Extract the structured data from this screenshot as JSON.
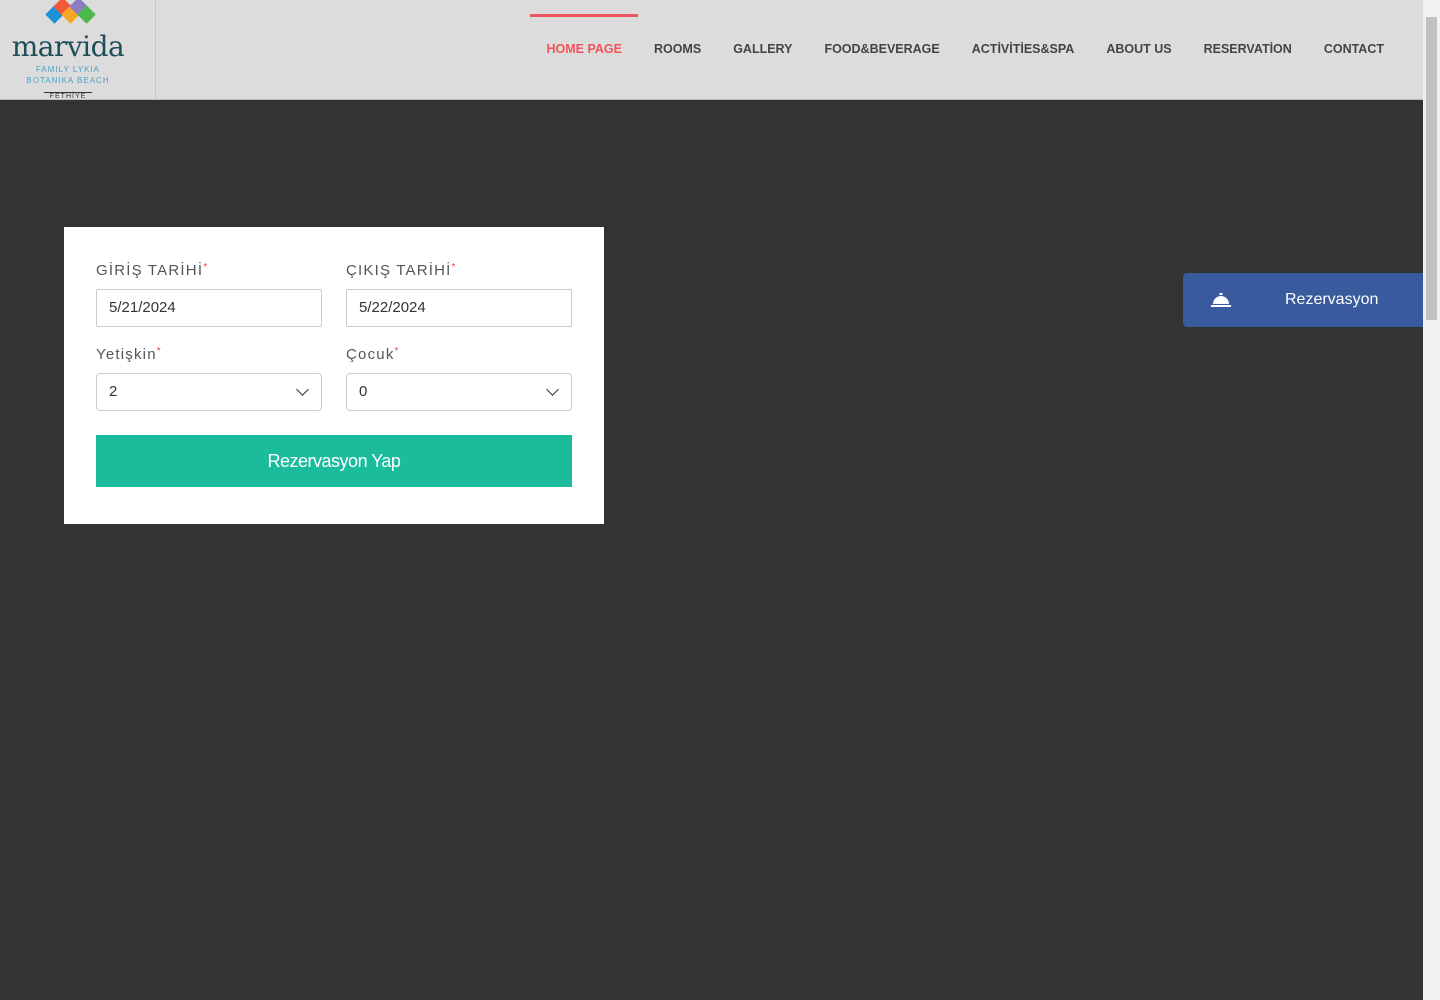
{
  "logo": {
    "name": "marvida",
    "line1": "FAMILY LYKIA",
    "line2": "BOTANIKA BEACH",
    "line3": "FETHİYE",
    "colors": [
      "#f05a3a",
      "#8e7cc3",
      "#1e90d8",
      "#f5a623",
      "#4cb84c"
    ]
  },
  "nav": {
    "items": [
      {
        "label": "HOME PAGE",
        "active": true
      },
      {
        "label": "ROOMS"
      },
      {
        "label": "GALLERY"
      },
      {
        "label": "FOOD&BEVERAGE"
      },
      {
        "label": "ACTİVİTİES&SPA"
      },
      {
        "label": "ABOUT US"
      },
      {
        "label": "RESERVATİON"
      },
      {
        "label": "CONTACT"
      }
    ]
  },
  "form": {
    "checkin": {
      "label": "GİRİŞ TARİHİ",
      "value": "5/21/2024"
    },
    "checkout": {
      "label": "ÇIKIŞ TARİHİ",
      "value": "5/22/2024"
    },
    "adults": {
      "label": "Yetişkin",
      "value": "2"
    },
    "children": {
      "label": "Çocuk",
      "value": "0"
    },
    "required": "*",
    "submit": "Rezervasyon Yap"
  },
  "side_button": {
    "label": "Rezervasyon",
    "icon": "concierge-bell-icon"
  },
  "colors": {
    "accent": "#f0545b",
    "submit": "#1abc9c",
    "side": "#3a5a9e"
  }
}
